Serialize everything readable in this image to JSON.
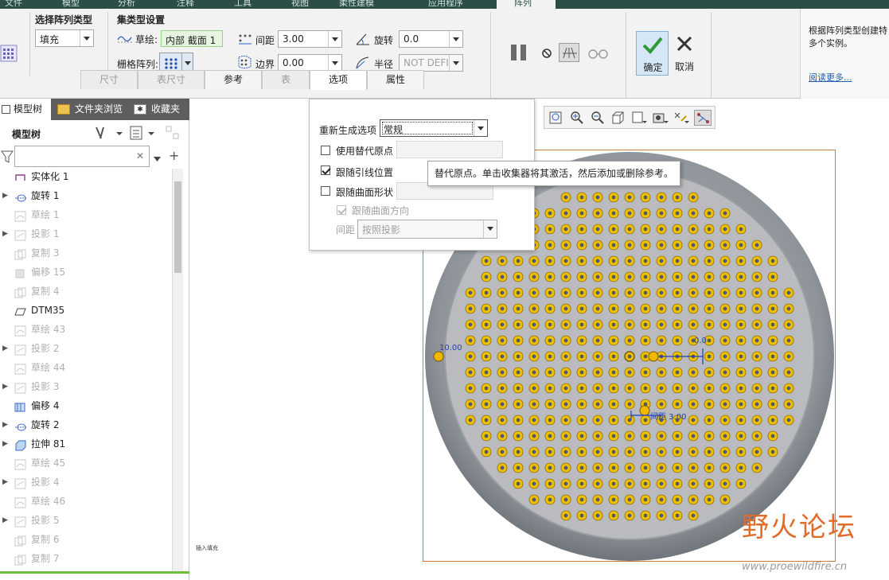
{
  "menu_tabs": [
    "文件",
    "模型",
    "分析",
    "注释",
    "工具",
    "视图",
    "柔性建模",
    "应用程序",
    "阵列"
  ],
  "ribbon": {
    "group_type_title": "选择阵列类型",
    "type_value": "填充",
    "group_set_title": "集类型设置",
    "sketch_label": "草绘:",
    "sketch_value": "内部 截面 1",
    "grid_label": "栅格阵列:",
    "spacing_label": "间距",
    "spacing_value": "3.00",
    "border_label": "边界",
    "border_value": "0.00",
    "rotate_label": "旋转",
    "rotate_value": "0.0",
    "radius_label": "半径",
    "radius_value": "NOT DEFI",
    "ok_label": "确定",
    "cancel_label": "取消",
    "subtabs": [
      "尺寸",
      "表尺寸",
      "参考",
      "表",
      "选项",
      "属性"
    ]
  },
  "help": {
    "text": "根据阵列类型创建特多个实例。",
    "link": "阅读更多..."
  },
  "left_panel": {
    "tabs": [
      "模型树",
      "文件夹浏览",
      "收藏夹"
    ],
    "header": "模型树",
    "items": [
      {
        "label": "实体化 1",
        "dim": false,
        "exp": false,
        "icon": "solidify-icon"
      },
      {
        "label": "旋转 1",
        "dim": false,
        "exp": true,
        "icon": "revolve-icon"
      },
      {
        "label": "草绘 1",
        "dim": true,
        "exp": false,
        "icon": "sketch-icon"
      },
      {
        "label": "投影 1",
        "dim": true,
        "exp": true,
        "icon": "project-icon"
      },
      {
        "label": "复制 3",
        "dim": true,
        "exp": false,
        "icon": "copy-icon"
      },
      {
        "label": "偏移 15",
        "dim": true,
        "exp": false,
        "icon": "offset-icon"
      },
      {
        "label": "复制 4",
        "dim": true,
        "exp": false,
        "icon": "copy-icon"
      },
      {
        "label": "DTM35",
        "dim": false,
        "exp": false,
        "icon": "datum-plane-icon"
      },
      {
        "label": "草绘 43",
        "dim": true,
        "exp": false,
        "icon": "sketch-icon"
      },
      {
        "label": "投影 2",
        "dim": true,
        "exp": true,
        "icon": "project-icon"
      },
      {
        "label": "草绘 44",
        "dim": true,
        "exp": false,
        "icon": "sketch-icon"
      },
      {
        "label": "投影 3",
        "dim": true,
        "exp": true,
        "icon": "project-icon"
      },
      {
        "label": "偏移 4",
        "dim": false,
        "exp": false,
        "icon": "offset-icon"
      },
      {
        "label": "旋转 2",
        "dim": false,
        "exp": true,
        "icon": "revolve-icon"
      },
      {
        "label": "拉伸 81",
        "dim": false,
        "exp": true,
        "icon": "extrude-icon"
      },
      {
        "label": "草绘 45",
        "dim": true,
        "exp": false,
        "icon": "sketch-icon"
      },
      {
        "label": "投影 4",
        "dim": true,
        "exp": true,
        "icon": "project-icon"
      },
      {
        "label": "草绘 46",
        "dim": true,
        "exp": false,
        "icon": "sketch-icon"
      },
      {
        "label": "投影 5",
        "dim": true,
        "exp": true,
        "icon": "project-icon"
      },
      {
        "label": "复制 6",
        "dim": true,
        "exp": false,
        "icon": "copy-icon"
      },
      {
        "label": "复制 7",
        "dim": true,
        "exp": false,
        "icon": "copy-icon"
      }
    ]
  },
  "options_panel": {
    "regen_label": "重新生成选项",
    "regen_value": "常规",
    "alt_origin_label": "使用替代原点",
    "follow_leader_label": "跟随引线位置",
    "follow_surface_label": "跟随曲面形状",
    "follow_dir_label": "跟随曲面方向",
    "spacing_label": "间距",
    "spacing_value": "按照投影"
  },
  "tooltip": "替代原点。单击收集器将其激活，然后添加或删除参考。",
  "viewport": {
    "dim_left": "10.00",
    "dim_top": "0.0",
    "dim_spacing": "间距 3.00",
    "insert_text": "插入填充"
  },
  "watermark": {
    "text": "野火论坛",
    "url": "www.proewildfire.cn"
  },
  "colors": {
    "accent": "#2b4f47",
    "dot": "#f0c000",
    "disk": "#8f959b"
  }
}
